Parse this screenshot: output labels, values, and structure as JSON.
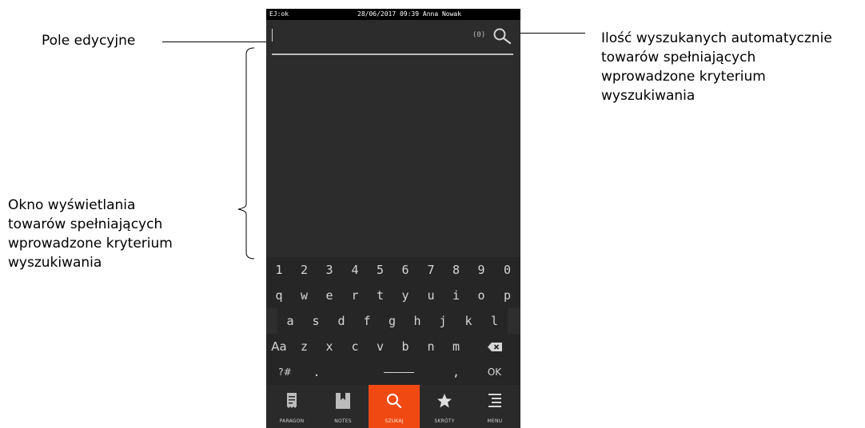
{
  "annotations": {
    "edit_field": "Pole edycyjne",
    "found_count": [
      "Ilość wyszukanych automatycznie",
      "towarów spełniających",
      "wprowadzone kryterium",
      "wyszukiwania"
    ],
    "results_window": [
      "Okno wyświetlania",
      "towarów spełniających",
      "wprowadzone kryterium",
      "wyszukiwania"
    ]
  },
  "status_bar": {
    "left": "EJ:ok",
    "center": "28/06/2017 09:39 Anna Nowak"
  },
  "search": {
    "count": "(0)",
    "icon": "search-icon"
  },
  "keyboard": {
    "row1": [
      "1",
      "2",
      "3",
      "4",
      "5",
      "6",
      "7",
      "8",
      "9",
      "0"
    ],
    "row2": [
      "q",
      "w",
      "e",
      "r",
      "t",
      "y",
      "u",
      "i",
      "o",
      "p"
    ],
    "row3": [
      "a",
      "s",
      "d",
      "f",
      "g",
      "h",
      "j",
      "k",
      "l"
    ],
    "row4": [
      "Aa",
      "z",
      "x",
      "c",
      "v",
      "b",
      "n",
      "m"
    ],
    "row5": {
      "symbols": "?#",
      "dot": ".",
      "comma": ",",
      "ok": "OK"
    },
    "backspace_icon": "backspace-icon",
    "space_icon": "spacebar-icon"
  },
  "nav": {
    "items": [
      {
        "label": "PARAGON",
        "icon": "receipt-icon"
      },
      {
        "label": "NOTES",
        "icon": "notes-icon"
      },
      {
        "label": "SZUKAJ",
        "icon": "search-icon"
      },
      {
        "label": "SKRÓTY",
        "icon": "star-icon"
      },
      {
        "label": "MENU",
        "icon": "menu-icon"
      }
    ],
    "active": "SZUKAJ",
    "active_color": "#f04a12"
  }
}
